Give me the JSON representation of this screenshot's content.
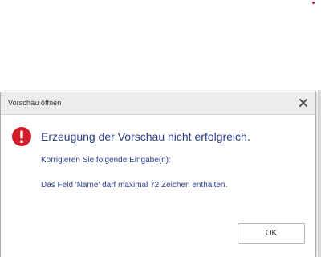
{
  "dialog": {
    "title": "Vorschau öffnen",
    "close_icon": "close-icon",
    "error_icon": "error-icon",
    "heading": "Erzeugung der Vorschau nicht erfolgreich.",
    "subtext": "Korrigieren Sie folgende Eingabe(n):",
    "detail": "Das Feld 'Name' darf maximal 72 Zeichen enthalten.",
    "ok_label": "OK"
  },
  "colors": {
    "error_red": "#d31d2b",
    "text_blue": "#2b3f8c",
    "titlebar": "#ececec"
  }
}
